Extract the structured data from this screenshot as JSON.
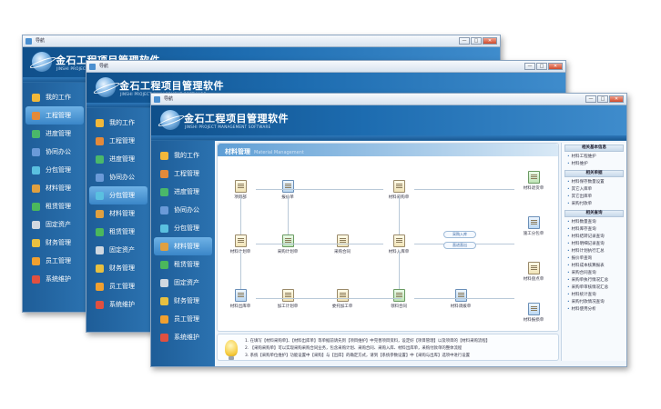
{
  "window_title": "导航",
  "app": {
    "title": "金石工程项目管理软件",
    "subtitle": "JINSHI PROJECT MANAGEMENT SOFTWARE"
  },
  "window_buttons": [
    "—",
    "□",
    "✕"
  ],
  "sidebar_back": [
    "我的工作",
    "工程管理",
    "进度管理",
    "协同办公",
    "分包管理",
    "材料管理",
    "租赁管理",
    "固定资产",
    "财务管理",
    "员工管理",
    "系统维护"
  ],
  "sidebar_front": [
    {
      "label": "我的工作",
      "icon": "folder-icon",
      "color": "#f1b83a"
    },
    {
      "label": "工程管理",
      "icon": "project-icon",
      "color": "#e48a3a"
    },
    {
      "label": "进度管理",
      "icon": "schedule-icon",
      "color": "#4ab86a"
    },
    {
      "label": "协同办公",
      "icon": "collaboration-icon",
      "color": "#6a9ad8"
    },
    {
      "label": "分包管理",
      "icon": "subcontract-icon",
      "color": "#5ac0e0"
    },
    {
      "label": "材料管理",
      "icon": "materials-icon",
      "color": "#e0a040"
    },
    {
      "label": "租赁管理",
      "icon": "lease-icon",
      "color": "#4bb85c"
    },
    {
      "label": "固定资产",
      "icon": "assets-icon",
      "color": "#d0d8e0"
    },
    {
      "label": "财务管理",
      "icon": "finance-icon",
      "color": "#e8c040"
    },
    {
      "label": "员工管理",
      "icon": "staff-icon",
      "color": "#f0a030"
    },
    {
      "label": "系统维护",
      "icon": "maintenance-icon",
      "color": "#e05040"
    }
  ],
  "active_nav": "材料管理",
  "panel": {
    "title": "材料管理",
    "subtitle": "Material Management"
  },
  "flow_nodes": [
    "项目部",
    "报价单",
    "材料采购单",
    "材料计划单",
    "采购计划单",
    "采购合同",
    "材料入库单",
    "材料出库单",
    "加工计划单",
    "委托加工单",
    "领料合同",
    "材料调拨单",
    "材料退货单",
    "施工分包单",
    "材料盘点单",
    "材料报损单"
  ],
  "flow_pills": [
    "采购入库",
    "直进直出"
  ],
  "right_panel": {
    "sections": [
      {
        "title": "相关基本信息",
        "items": [
          "材料工程维护",
          "材料维护"
        ]
      },
      {
        "title": "相关单据",
        "items": [
          "材料保存数量设置",
          "其它入库单",
          "其它出库单",
          "采购付款单"
        ]
      },
      {
        "title": "相关查询",
        "items": [
          "材料数量查询",
          "材料库存查询",
          "材料结转记录查询",
          "材料明细记录查询",
          "材料计划执行汇总",
          "报价单查询",
          "材料成本核算报表",
          "采购合同查询",
          "采购单执行情况汇总",
          "采购单审核情况汇总",
          "材料统计查询",
          "采购付款情况查询",
          "材料使用分析"
        ]
      }
    ]
  },
  "tips": [
    "1. 在填写【材料采购单】、【材料出库单】等单据前请先到【项目维护】中完善项目资料，设定好【项目管理】以及项目的【材料采购流程】",
    "2. 【采购采购单】可以实现采购采购合同业务，包含采购计划、采购合同、采购入库、材料出库单，采购付款单的整体流程",
    "3. 系统【采购单位维护】功能设置中【采购】与【出库】的确定方式，请到【系统参数设置】中【采购与出库】选项中进行设置"
  ],
  "colors": {
    "header": "#1d6cb0",
    "sidebar": "#2b72b0",
    "content_bg": "#eef4fa",
    "accent": "#3a86c8"
  }
}
